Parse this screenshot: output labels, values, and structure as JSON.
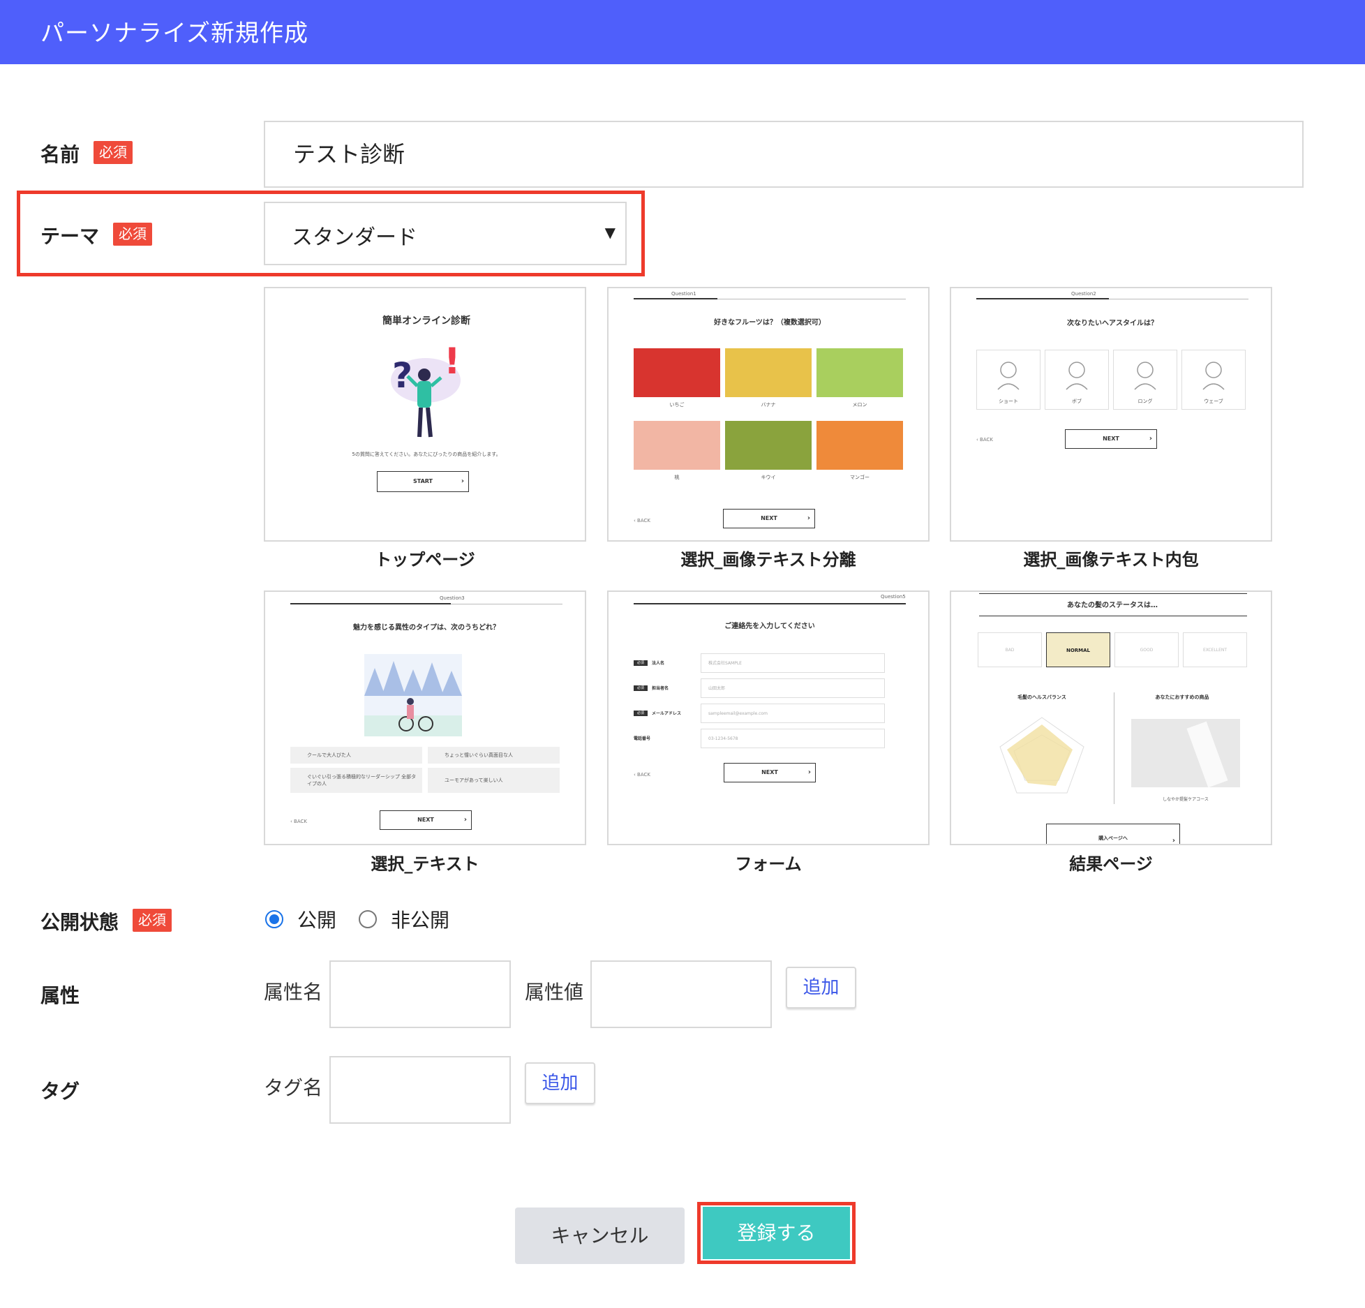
{
  "header": {
    "title": "パーソナライズ新規作成"
  },
  "required_badge": "必須",
  "name_field": {
    "label": "名前",
    "value": "テスト診断"
  },
  "theme_field": {
    "label": "テーマ",
    "value": "スタンダード"
  },
  "templates": [
    {
      "caption": "トップページ",
      "preview": {
        "title": "簡単オンライン診断",
        "text": "5の質問に答えてください。あなたにぴったりの商品を紹介します。",
        "button": "START"
      }
    },
    {
      "caption": "選択_画像テキスト分離",
      "preview": {
        "question_no": "Question1",
        "title": "好きなフルーツは？（複数選択可）",
        "options": [
          "いちご",
          "バナナ",
          "メロン",
          "桃",
          "キウイ",
          "マンゴー"
        ],
        "back": "BACK",
        "button": "NEXT"
      }
    },
    {
      "caption": "選択_画像テキスト内包",
      "preview": {
        "question_no": "Question2",
        "title": "次なりたいヘアスタイルは？",
        "options": [
          "ショート",
          "ボブ",
          "ロング",
          "ウェーブ"
        ],
        "back": "BACK",
        "button": "NEXT"
      }
    },
    {
      "caption": "選択_テキスト",
      "preview": {
        "question_no": "Question3",
        "title": "魅力を感じる異性のタイプは、次のうちどれ？",
        "options": [
          "クールで大人びた人",
          "ちょっと憧いぐらい真面目な人",
          "ぐいぐい引っ張る積極的なリーダーシップ 全部タイプの人",
          "ユーモアがあって楽しい人"
        ],
        "back": "BACK",
        "button": "NEXT"
      }
    },
    {
      "caption": "フォーム",
      "preview": {
        "question_no": "Question5",
        "title": "ご連絡先を入力してください",
        "required": "必須",
        "fields": [
          {
            "label": "法人名",
            "placeholder": "株式会社SAMPLE"
          },
          {
            "label": "担当者名",
            "placeholder": "山田太郎"
          },
          {
            "label": "メールアドレス",
            "placeholder": "sampleemail@example.com"
          },
          {
            "label": "電話番号",
            "placeholder": "03-1234-5678"
          }
        ],
        "back": "BACK",
        "button": "NEXT"
      }
    },
    {
      "caption": "結果ページ",
      "preview": {
        "title": "あなたの髪のステータスは…",
        "statuses": [
          "BAD",
          "NORMAL",
          "GOOD",
          "EXCELLENT"
        ],
        "selected_status": "NORMAL",
        "left_title": "毛髪のヘルスバランス",
        "right_title": "あなたにおすすめの商品",
        "product_caption": "しなやか提髪ケアコース",
        "button": "購入ページへ"
      }
    }
  ],
  "visibility": {
    "label": "公開状態",
    "options": [
      "公開",
      "非公開"
    ],
    "selected": "公開"
  },
  "attributes": {
    "label": "属性",
    "name_label": "属性名",
    "value_label": "属性値",
    "add_label": "追加"
  },
  "tags": {
    "label": "タグ",
    "name_label": "タグ名",
    "add_label": "追加"
  },
  "actions": {
    "cancel": "キャンセル",
    "submit": "登録する"
  },
  "colors": {
    "header": "#4f5ffb",
    "required": "#ef4a3a",
    "highlight": "#ee3a2b",
    "submit": "#3ec9c1",
    "link": "#3b57e8"
  }
}
